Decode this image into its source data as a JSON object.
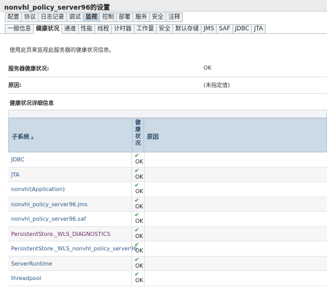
{
  "window": {
    "title": "nonvhl_policy_server96的设置"
  },
  "tabs_primary": [
    "配置",
    "协议",
    "日志记录",
    "调试",
    "监视",
    "控制",
    "部署",
    "服务",
    "安全",
    "注释"
  ],
  "tabs_primary_active": "监视",
  "tabs_secondary": [
    "一般信息",
    "健康状况",
    "通道",
    "性能",
    "线程",
    "计时器",
    "工作量",
    "安全",
    "默认存储",
    "JMS",
    "SAF",
    "JDBC",
    "JTA"
  ],
  "tabs_secondary_active": "健康状况",
  "page": {
    "description": "使用此页来监视此服务器的健康状况信息。",
    "fields": [
      {
        "label": "服务器健康状况:",
        "value": "OK"
      },
      {
        "label": "原因:",
        "value": "(未指定值)"
      }
    ],
    "section_title": "健康状况详细信息"
  },
  "table": {
    "columns": {
      "subsystem": "子系统",
      "sort_icon": "sort-ascending-icon",
      "state_chars": [
        "健",
        "康",
        "状",
        "况"
      ],
      "reason": "原因"
    },
    "rows": [
      {
        "name": "JDBC",
        "state": "OK",
        "reason": "",
        "visited": false
      },
      {
        "name": "JTA",
        "state": "OK",
        "reason": "",
        "visited": false
      },
      {
        "name": "nonvhl(Application)",
        "state": "OK",
        "reason": "",
        "visited": false
      },
      {
        "name": "nonvhl_policy_server96.jms",
        "state": "OK",
        "reason": "",
        "visited": false
      },
      {
        "name": "nonvhl_policy_server96.saf",
        "state": "OK",
        "reason": "",
        "visited": false
      },
      {
        "name": "PersistentStore._WLS_DIAGNOSTICS",
        "state": "OK",
        "reason": "",
        "visited": true
      },
      {
        "name": "PersistentStore._WLS_nonvhl_policy_server96",
        "state": "OK",
        "reason": "",
        "visited": false
      },
      {
        "name": "ServerRuntime",
        "state": "OK",
        "reason": "",
        "visited": false
      },
      {
        "name": "threadpool",
        "state": "OK",
        "reason": "",
        "visited": false
      }
    ],
    "state_icon": "ok-checkmark-icon"
  },
  "colors": {
    "link": "#2e5a8a",
    "visited_link": "#6b2d6b",
    "check": "#2f8f2f",
    "header_bg": "#ccdae6"
  }
}
